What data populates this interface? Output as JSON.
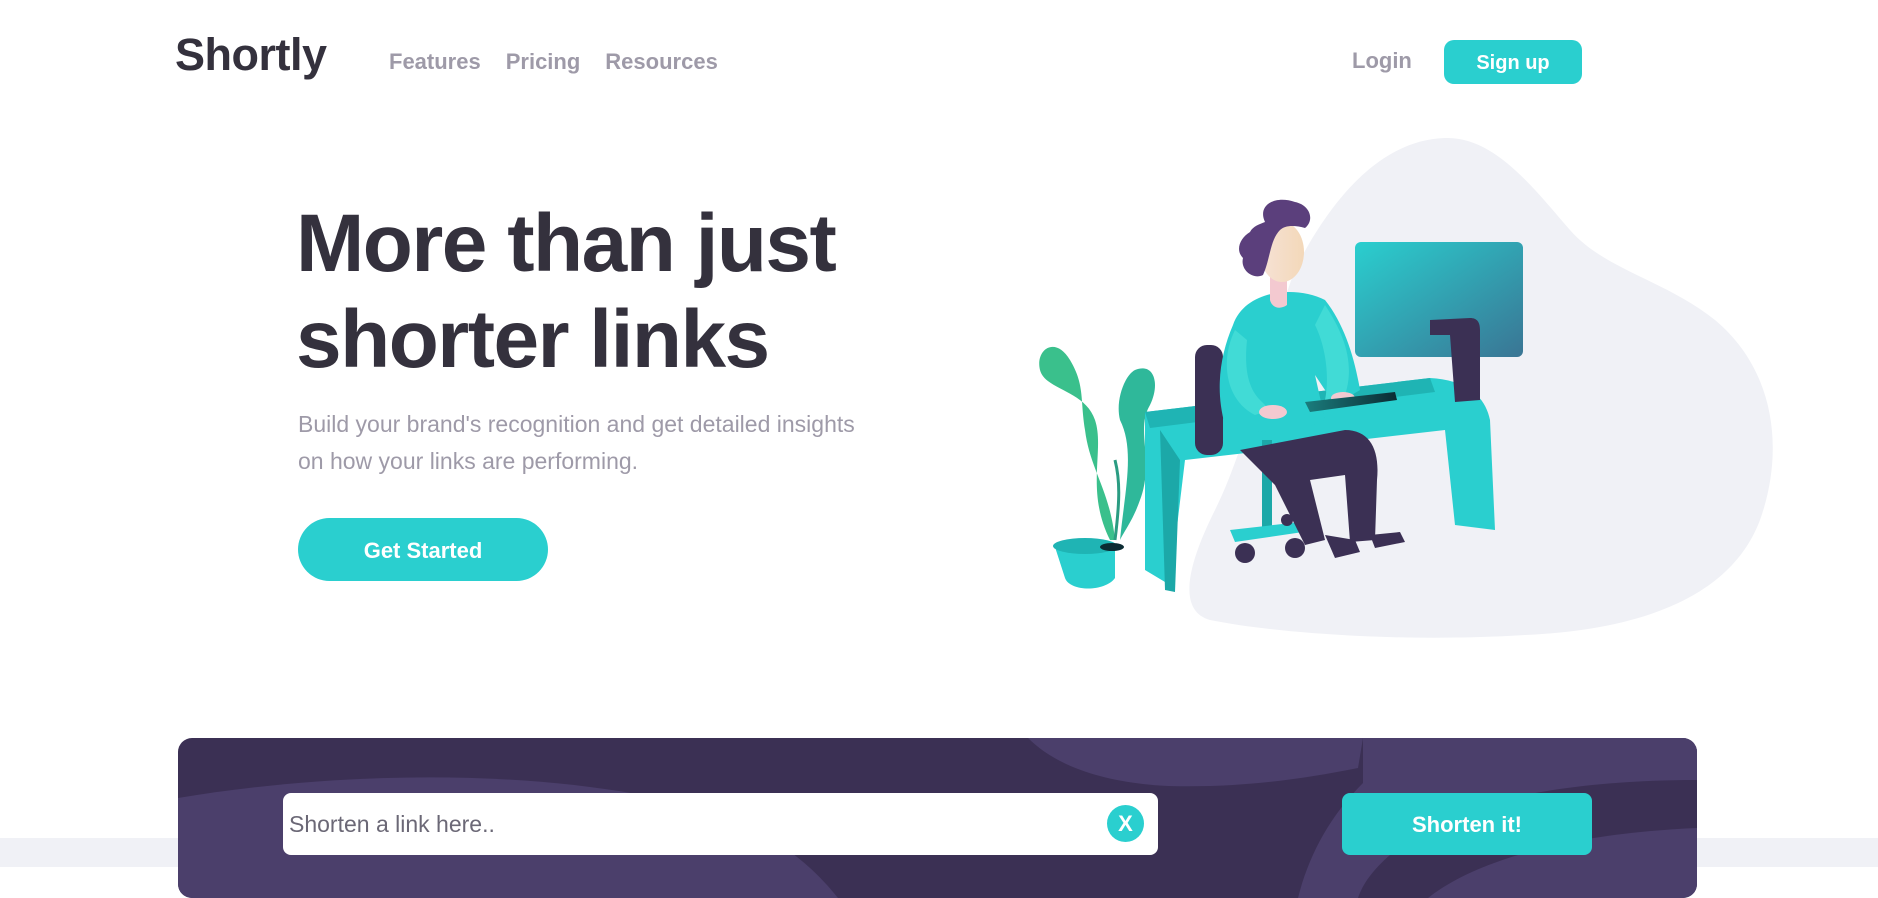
{
  "brand": {
    "logo": "Shortly"
  },
  "nav": {
    "items": [
      {
        "label": "Features"
      },
      {
        "label": "Pricing"
      },
      {
        "label": "Resources"
      }
    ],
    "login_label": "Login",
    "signup_label": "Sign up"
  },
  "hero": {
    "title_line_1": "More than just",
    "title_line_2": "shorter links",
    "subtitle_line_1": "Build your brand's recognition and get detailed insights",
    "subtitle_line_2": "on how your links are performing.",
    "cta_label": "Get Started",
    "illustration_icon": "person-working-at-desk-illustration"
  },
  "shorten": {
    "input_value": "",
    "input_placeholder": "Shorten a link here..",
    "clear_label": "X",
    "button_label": "Shorten it!"
  },
  "colors": {
    "primary": "#2acfcf",
    "dark_violet": "#3b3054",
    "heading": "#34313d",
    "gray_text": "#9e9aa8",
    "light_bg": "#f0f1f6"
  }
}
